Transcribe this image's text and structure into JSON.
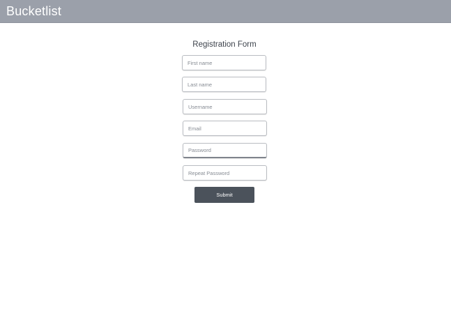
{
  "navbar": {
    "brand": "Bucketlist"
  },
  "form": {
    "title": "Registration Form",
    "fields": {
      "first_name": {
        "value": "",
        "placeholder": "First name"
      },
      "last_name": {
        "value": "",
        "placeholder": "Last name"
      },
      "username": {
        "value": "",
        "placeholder": "Username"
      },
      "email": {
        "value": "",
        "placeholder": "Email"
      },
      "password": {
        "value": "",
        "placeholder": "Password"
      },
      "repeat_password": {
        "value": "",
        "placeholder": "Repeat Password"
      }
    },
    "submit_label": "Submit"
  },
  "colors": {
    "navbar_bg": "#9ba0aa",
    "button_bg": "#4b525b",
    "title_text": "#3d434c"
  }
}
